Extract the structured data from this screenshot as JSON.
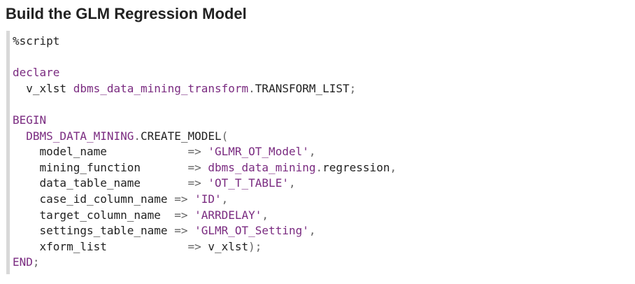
{
  "page": {
    "title": "Build the GLM Regression Model"
  },
  "code": {
    "line01": "%script",
    "line03": "declare",
    "line04_indent": "  ",
    "line04_var": "v_xlst ",
    "line04_type": "dbms_data_mining_transform",
    "line04_dot": ".",
    "line04_list": "TRANSFORM_LIST",
    "line04_semi": ";",
    "line06": "BEGIN",
    "line07_indent": "  ",
    "line07_pkg": "DBMS_DATA_MINING",
    "line07_dot": ".",
    "line07_proc": "CREATE_MODEL",
    "line07_paren": "(",
    "params": [
      {
        "indent": "    ",
        "name": "model_name            ",
        "arrow": "=> ",
        "value": "'GLMR_OT_Model'",
        "tail": ","
      },
      {
        "indent": "    ",
        "name": "mining_function       ",
        "arrow": "=> ",
        "value_pkg": "dbms_data_mining",
        "value_dot": ".",
        "value_plain": "regression",
        "tail": ","
      },
      {
        "indent": "    ",
        "name": "data_table_name       ",
        "arrow": "=> ",
        "value": "'OT_T_TABLE'",
        "tail": ","
      },
      {
        "indent": "    ",
        "name": "case_id_column_name ",
        "arrow": "=> ",
        "value": "'ID'",
        "tail": ","
      },
      {
        "indent": "    ",
        "name": "target_column_name  ",
        "arrow": "=> ",
        "value": "'ARRDELAY'",
        "tail": ","
      },
      {
        "indent": "    ",
        "name": "settings_table_name ",
        "arrow": "=> ",
        "value": "'GLMR_OT_Setting'",
        "tail": ","
      },
      {
        "indent": "    ",
        "name": "xform_list            ",
        "arrow": "=> ",
        "value_plain": "v_xlst",
        "tail": ");"
      }
    ],
    "line15_end": "END",
    "line15_semi": ";"
  },
  "colors": {
    "keyword": "#7a2b80",
    "text": "#222222",
    "punctuation": "#666666",
    "border": "#d8d8d8"
  }
}
